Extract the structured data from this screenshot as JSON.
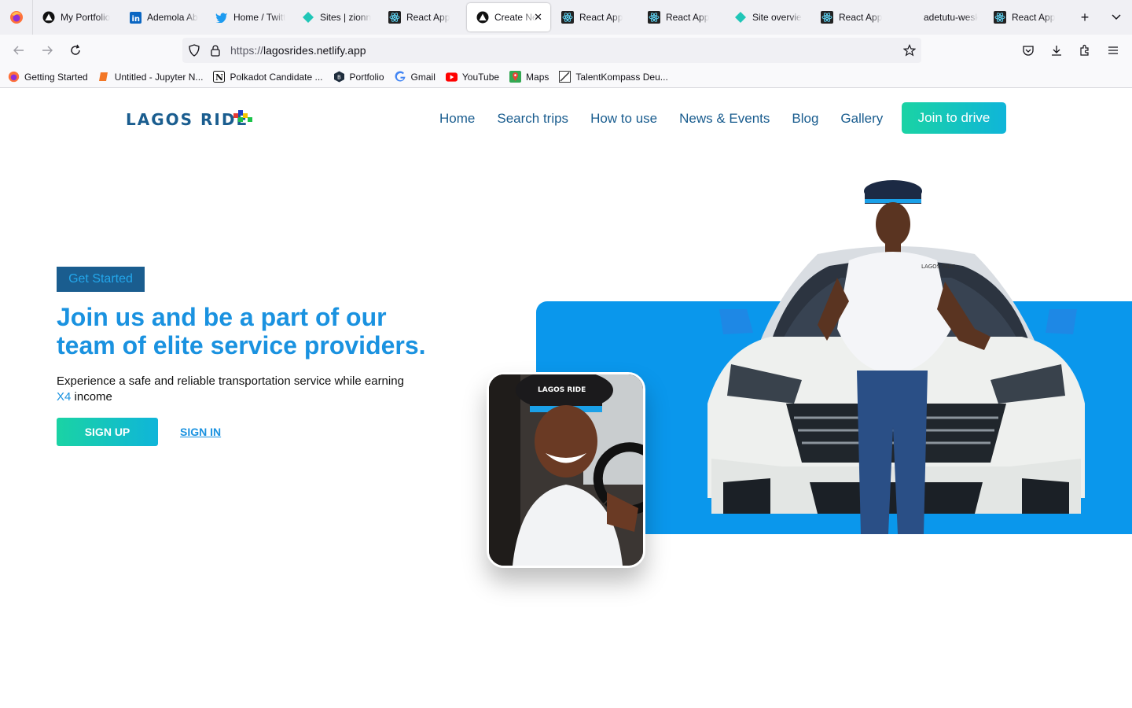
{
  "browser": {
    "tabs": [
      {
        "label": "My Portfolio",
        "icon": "triangle-circle-icon"
      },
      {
        "label": "Ademola Ab",
        "icon": "linkedin-icon"
      },
      {
        "label": "Home / Twitt",
        "icon": "twitter-icon"
      },
      {
        "label": "Sites | zionn",
        "icon": "netlify-icon"
      },
      {
        "label": "React App",
        "icon": "react-icon"
      },
      {
        "label": "Create Ne",
        "icon": "triangle-circle-icon",
        "active": true
      },
      {
        "label": "React App",
        "icon": "react-icon"
      },
      {
        "label": "React App",
        "icon": "react-icon"
      },
      {
        "label": "Site overvie",
        "icon": "netlify-icon"
      },
      {
        "label": "React App",
        "icon": "react-icon"
      },
      {
        "label": "adetutu-weskilly",
        "icon": "none"
      },
      {
        "label": "React App",
        "icon": "react-icon"
      }
    ],
    "url_proto": "https://",
    "url_host": "lagosrides.netlify.app",
    "bookmarks": [
      {
        "label": "Getting Started",
        "icon": "firefox-icon"
      },
      {
        "label": "Untitled - Jupyter N...",
        "icon": "jupyter-icon"
      },
      {
        "label": "Polkadot Candidate ...",
        "icon": "notion-icon"
      },
      {
        "label": "Portfolio",
        "icon": "hexagon-icon"
      },
      {
        "label": "Gmail",
        "icon": "google-icon"
      },
      {
        "label": "YouTube",
        "icon": "youtube-icon"
      },
      {
        "label": "Maps",
        "icon": "maps-icon"
      },
      {
        "label": "TalentKompass Deu...",
        "icon": "talent-icon"
      }
    ]
  },
  "site": {
    "logo_text": "LAGOS RIDE",
    "nav": [
      "Home",
      "Search trips",
      "How to use",
      "News & Events",
      "Blog",
      "Gallery"
    ],
    "cta_label": "Join to drive",
    "badge": "Get Started",
    "headline": "Join us and be a part of our team of elite service providers.",
    "sub_text": "Experience a safe and reliable transportation service while earning",
    "sub_highlight": "X4",
    "sub_tail": "income",
    "signup_label": "SIGN UP",
    "signin_label": "SIGN IN",
    "cap_text": "LAGOS RIDE",
    "colors": {
      "brand": "#1a5d8f",
      "accent": "#1a92e0",
      "panel": "#0a97ec",
      "gradient_start": "#1ad3a4",
      "gradient_end": "#0fb5d9"
    }
  }
}
